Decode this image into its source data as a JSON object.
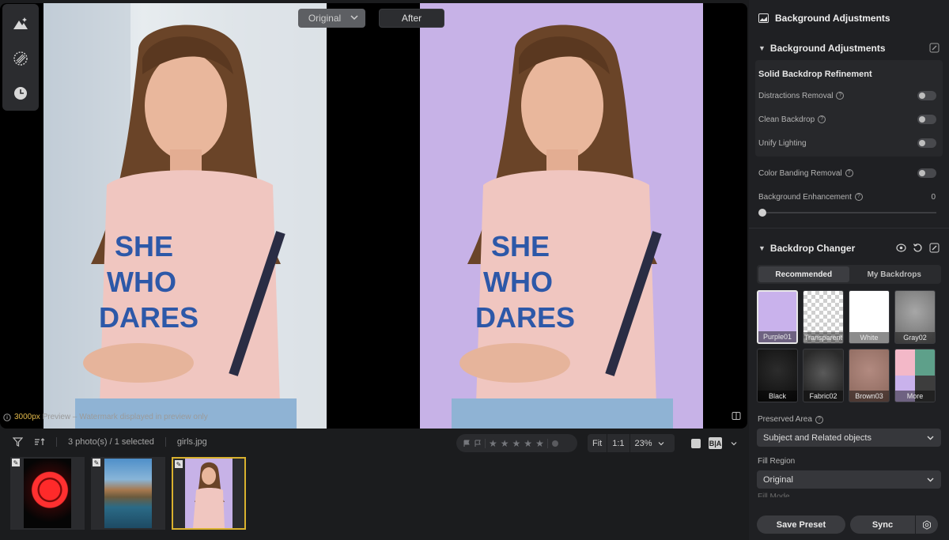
{
  "canvas": {
    "compare_original": "Original",
    "compare_after": "After",
    "preview_px": "3000px",
    "preview_text": " Preview – Watermark displayed in preview only"
  },
  "bottombar": {
    "photo_count": "3 photo(s) / 1 selected",
    "filename": "girls.jpg",
    "zoom_fit": "Fit",
    "zoom_1to1": "1:1",
    "zoom_percent": "23%",
    "view_ba": "B|A"
  },
  "panel": {
    "title": "Background Adjustments",
    "section_title": "Background Adjustments",
    "card_title": "Solid Backdrop Refinement",
    "distractions": "Distractions Removal",
    "clean_backdrop": "Clean Backdrop",
    "unify_lighting": "Unify Lighting",
    "color_banding": "Color Banding Removal",
    "bg_enhancement": "Background Enhancement",
    "bg_enhancement_value": "0",
    "backdrop_title": "Backdrop Changer",
    "tab_recommended": "Recommended",
    "tab_my": "My Backdrops",
    "swatches": [
      "Purple01",
      "Transparent",
      "White",
      "Gray02",
      "Black",
      "Fabric02",
      "Brown03",
      "More"
    ],
    "preserved_label": "Preserved Area",
    "preserved_value": "Subject and Related objects",
    "fill_label": "Fill Region",
    "fill_value": "Original",
    "fill_mode_label": "Fill Mode",
    "save_preset": "Save Preset",
    "sync": "Sync"
  },
  "colors": {
    "accent_selection": "#d9b12e",
    "backdrop_purple": "#c7b2e7"
  }
}
